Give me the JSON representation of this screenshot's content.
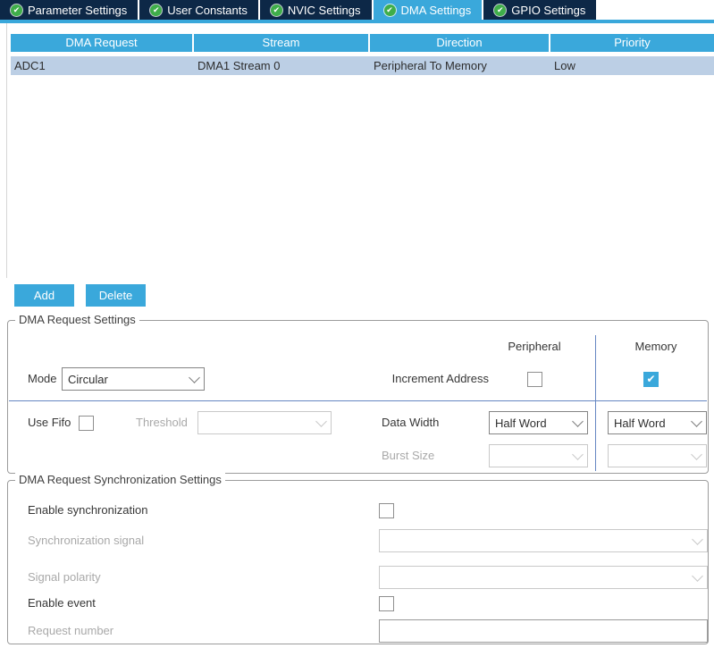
{
  "tabs": [
    {
      "label": "Parameter Settings",
      "active": false
    },
    {
      "label": "User Constants",
      "active": false
    },
    {
      "label": "NVIC Settings",
      "active": false
    },
    {
      "label": "DMA Settings",
      "active": true
    },
    {
      "label": "GPIO Settings",
      "active": false
    }
  ],
  "table": {
    "columns": [
      "DMA Request",
      "Stream",
      "Direction",
      "Priority"
    ],
    "rows": [
      {
        "dma_request": "ADC1",
        "stream": "DMA1 Stream 0",
        "direction": "Peripheral To Memory",
        "priority": "Low"
      }
    ]
  },
  "buttons": {
    "add": "Add",
    "delete": "Delete"
  },
  "dma_request_settings": {
    "legend": "DMA Request Settings",
    "col_peripheral": "Peripheral",
    "col_memory": "Memory",
    "mode_label": "Mode",
    "mode_value": "Circular",
    "increment_address_label": "Increment Address",
    "increment_peripheral_checked": false,
    "increment_memory_checked": true,
    "use_fifo_label": "Use Fifo",
    "use_fifo_checked": false,
    "threshold_label": "Threshold",
    "threshold_value": "",
    "data_width_label": "Data Width",
    "data_width_peripheral": "Half Word",
    "data_width_memory": "Half Word",
    "burst_size_label": "Burst Size",
    "burst_size_peripheral": "",
    "burst_size_memory": "",
    "check_mark": "✔"
  },
  "sync_settings": {
    "legend": "DMA Request Synchronization Settings",
    "enable_sync_label": "Enable synchronization",
    "enable_sync_checked": false,
    "sync_signal_label": "Synchronization signal",
    "sync_signal_value": "",
    "signal_polarity_label": "Signal polarity",
    "signal_polarity_value": "",
    "enable_event_label": "Enable event",
    "enable_event_checked": false,
    "request_number_label": "Request number",
    "request_number_value": ""
  },
  "icons": {
    "tab_check": "✔"
  },
  "colors": {
    "accent_blue": "#3aa8db",
    "tab_navy": "#0d2847",
    "selected_row": "#bccfe5",
    "separator_blue": "#6687c2",
    "check_green": "#3fae4a"
  }
}
